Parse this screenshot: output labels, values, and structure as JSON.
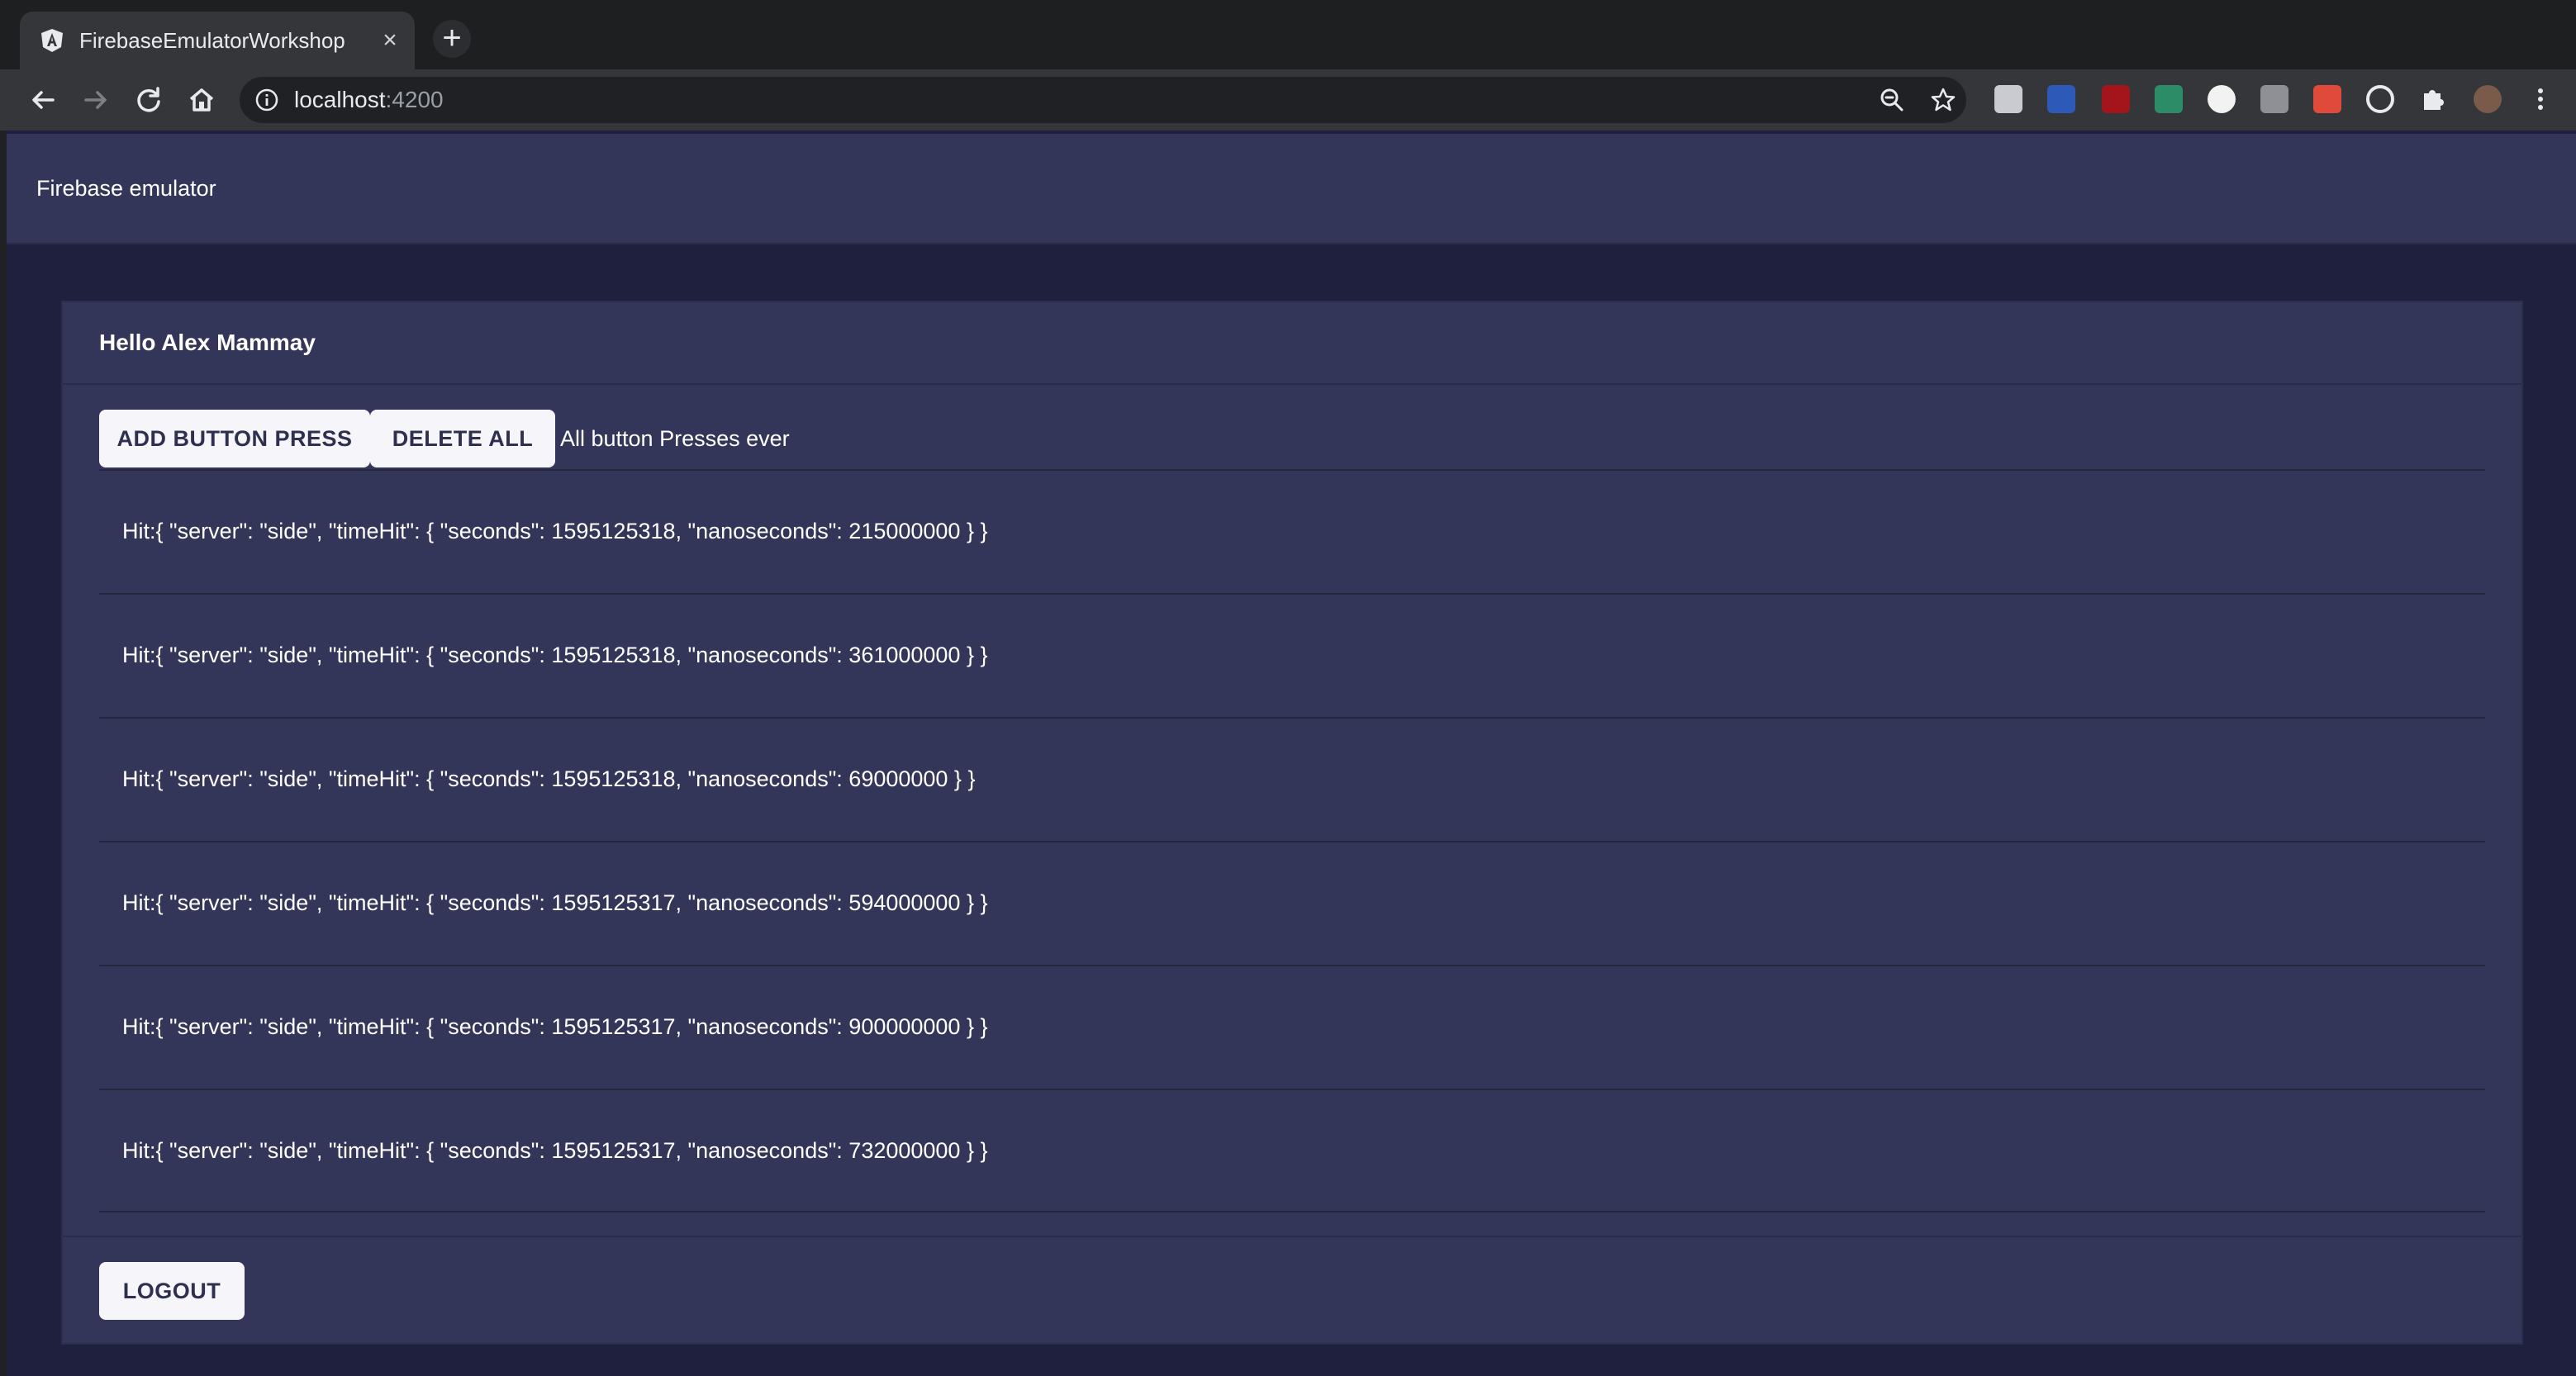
{
  "browser": {
    "tab_title": "FirebaseEmulatorWorkshop",
    "url_host": "localhost",
    "url_port": ":4200"
  },
  "app": {
    "title": "Firebase emulator"
  },
  "card": {
    "greeting": "Hello Alex Mammay",
    "add_button_label": "ADD BUTTON PRESS",
    "delete_button_label": "DELETE ALL",
    "presses_label": "All button Presses ever",
    "hits": [
      "Hit:{ \"server\": \"side\", \"timeHit\": { \"seconds\": 1595125318, \"nanoseconds\": 215000000 } }",
      "Hit:{ \"server\": \"side\", \"timeHit\": { \"seconds\": 1595125318, \"nanoseconds\": 361000000 } }",
      "Hit:{ \"server\": \"side\", \"timeHit\": { \"seconds\": 1595125318, \"nanoseconds\": 69000000 } }",
      "Hit:{ \"server\": \"side\", \"timeHit\": { \"seconds\": 1595125317, \"nanoseconds\": 594000000 } }",
      "Hit:{ \"server\": \"side\", \"timeHit\": { \"seconds\": 1595125317, \"nanoseconds\": 900000000 } }",
      "Hit:{ \"server\": \"side\", \"timeHit\": { \"seconds\": 1595125317, \"nanoseconds\": 732000000 } }"
    ],
    "logout_label": "LOGOUT"
  },
  "icons": {
    "favicon": "angular-icon",
    "back": "back-arrow-icon",
    "forward": "forward-arrow-icon",
    "reload": "reload-icon",
    "home": "home-icon",
    "info": "info-icon",
    "zoom": "zoom-icon",
    "bookmark": "star-icon"
  },
  "colors": {
    "page_background": "#1f203d",
    "surface": "#343659",
    "button": "#f5f5fa",
    "button_text": "#2f3050"
  }
}
